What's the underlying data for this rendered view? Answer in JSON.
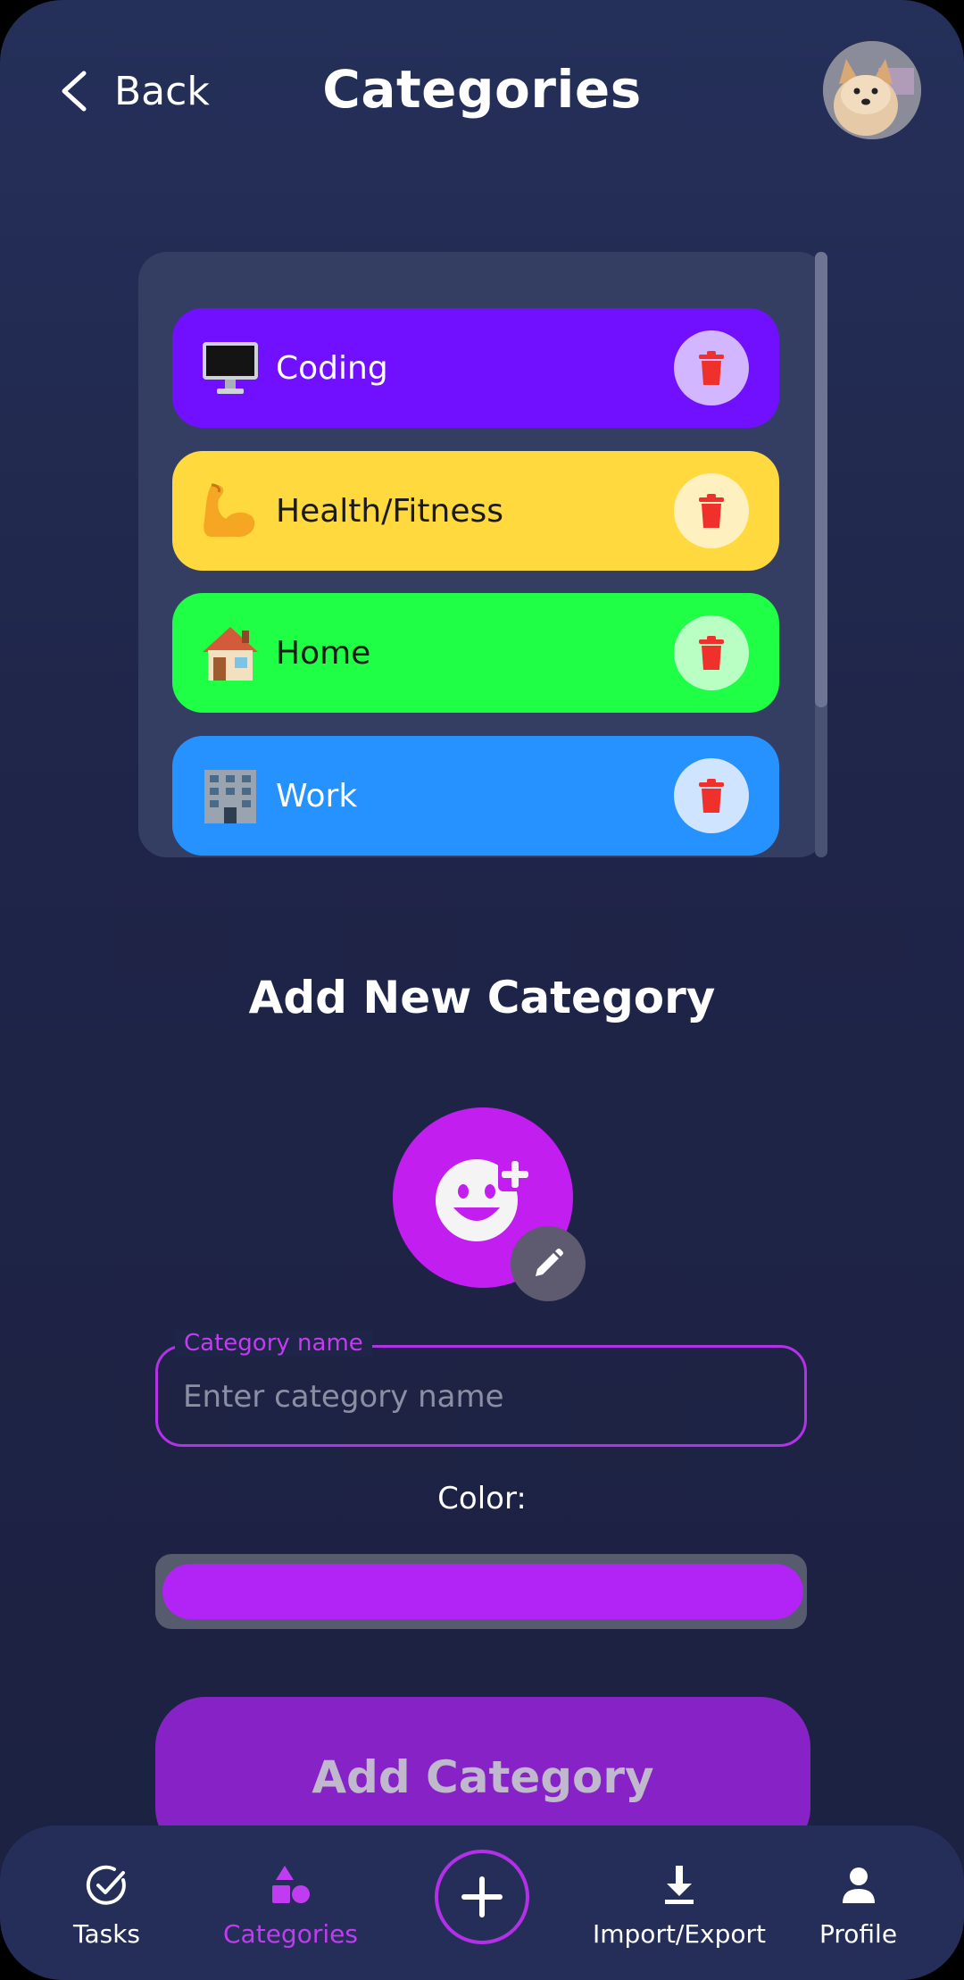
{
  "header": {
    "back_label": "Back",
    "title": "Categories"
  },
  "categories": [
    {
      "name": "Coding",
      "emoji": "desktop-computer",
      "color": "#7010ff",
      "text_color": "#ffffff",
      "delete_bg": "#d2b6ff"
    },
    {
      "name": "Health/Fitness",
      "emoji": "flexed-biceps",
      "color": "#ffd93e",
      "text_color": "#1a1a1a",
      "delete_bg": "#fff1bf"
    },
    {
      "name": "Home",
      "emoji": "house",
      "color": "#1fff45",
      "text_color": "#1a1a1a",
      "delete_bg": "#b9ffc4"
    },
    {
      "name": "Work",
      "emoji": "office-building",
      "color": "#2592ff",
      "text_color": "#ffffff",
      "delete_bg": "#cfe4ff"
    }
  ],
  "add_section": {
    "title": "Add New Category",
    "name_label": "Category name",
    "name_value": "",
    "name_placeholder": "Enter category name",
    "color_label": "Color:",
    "selected_color": "#b124f5",
    "submit_label": "Add Category"
  },
  "nav": {
    "tasks": "Tasks",
    "categories": "Categories",
    "import_export": "Import/Export",
    "profile": "Profile",
    "active": "categories"
  },
  "colors": {
    "accent": "#b332e8",
    "delete_icon": "#f0302a"
  }
}
